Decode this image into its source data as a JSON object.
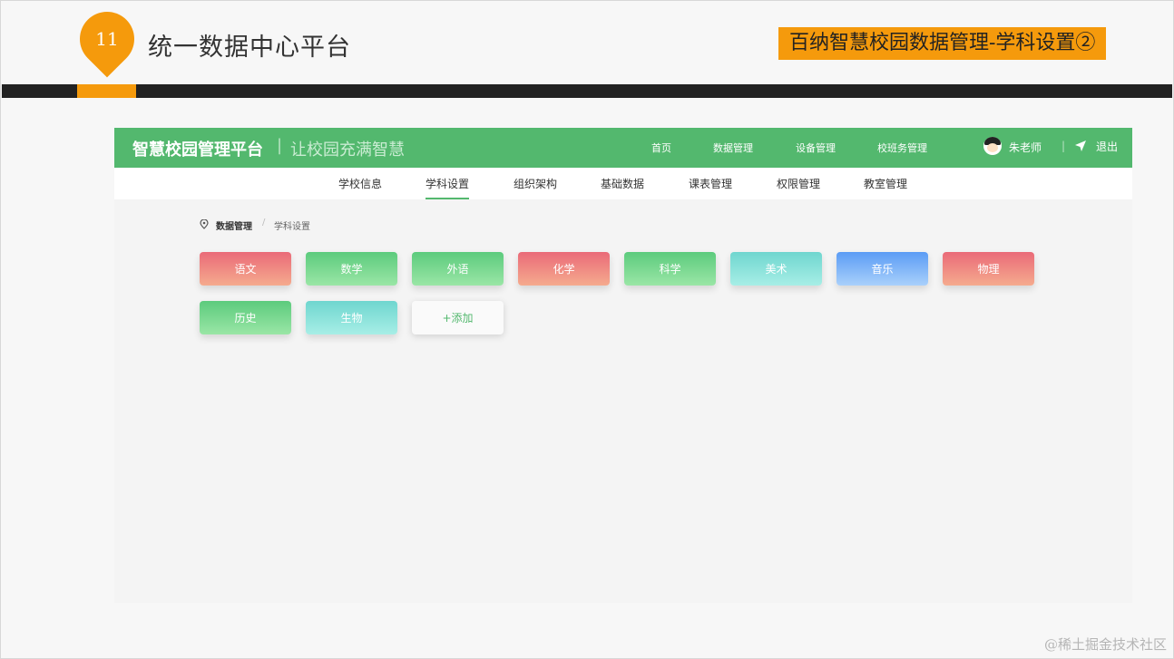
{
  "slide": {
    "number": "11",
    "title": "统一数据中心平台",
    "tag": "百纳智慧校园数据管理-学科设置②",
    "watermark": "@稀土掘金技术社区"
  },
  "app": {
    "brand": "智慧校园管理平台",
    "brand_separator": "|",
    "slogan": "让校园充满智慧",
    "top_nav": [
      "首页",
      "数据管理",
      "设备管理",
      "校班务管理"
    ],
    "user": {
      "name": "朱老师",
      "icon": "avatar"
    },
    "logout_icon": "send-icon",
    "logout_label": "退出",
    "sub_nav": [
      "学校信息",
      "学科设置",
      "组织架构",
      "基础数据",
      "课表管理",
      "权限管理",
      "教室管理"
    ],
    "sub_nav_active": "学科设置",
    "breadcrumb": {
      "icon": "location-pin-icon",
      "items": [
        "数据管理",
        "学科设置"
      ],
      "separator": "/"
    },
    "subjects": [
      {
        "label": "语文",
        "color": "red"
      },
      {
        "label": "数学",
        "color": "green"
      },
      {
        "label": "外语",
        "color": "green"
      },
      {
        "label": "化学",
        "color": "red"
      },
      {
        "label": "科学",
        "color": "green"
      },
      {
        "label": "美术",
        "color": "teal"
      },
      {
        "label": "音乐",
        "color": "blue"
      },
      {
        "label": "物理",
        "color": "red"
      },
      {
        "label": "历史",
        "color": "green"
      },
      {
        "label": "生物",
        "color": "teal"
      }
    ],
    "add_label": "+添加"
  },
  "colors": {
    "accent_orange": "#f59a0c",
    "brand_green": "#53b86e",
    "red": [
      "#ea6a78",
      "#f5ab8e"
    ],
    "green": [
      "#5ccb7d",
      "#9ae6a6"
    ],
    "teal": [
      "#6fd6cf",
      "#a7eee6"
    ],
    "blue": [
      "#5b9cf5",
      "#a9d0fb"
    ]
  }
}
